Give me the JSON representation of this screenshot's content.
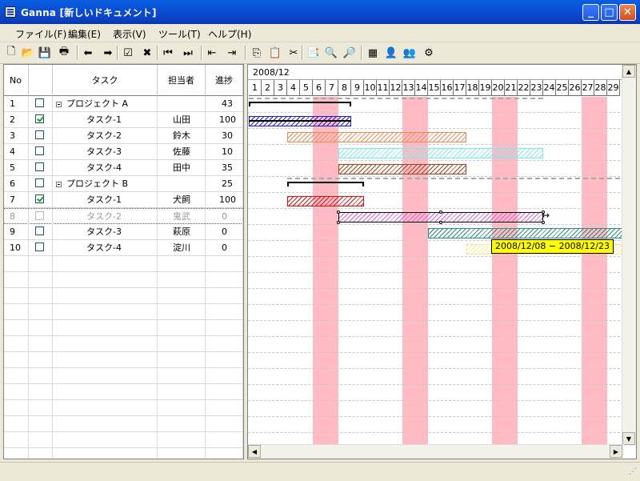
{
  "window": {
    "title": "Ganna [新しいドキュメント]",
    "minimize": "_",
    "maximize": "□",
    "close": "✕"
  },
  "menu": [
    "ファイル(F)",
    "編集(E)",
    "表示(V)",
    "ツール(T)",
    "ヘルプ(H)"
  ],
  "toolbar": [
    {
      "name": "new-icon",
      "glyph": "🗋"
    },
    {
      "name": "open-icon",
      "glyph": "📂"
    },
    {
      "name": "save-icon",
      "glyph": "💾"
    },
    {
      "name": "print-icon",
      "glyph": "🖶"
    },
    {
      "name": "arrow-left-icon",
      "glyph": "⬅"
    },
    {
      "name": "arrow-right-icon",
      "glyph": "➡"
    },
    {
      "name": "check-icon",
      "glyph": "☑"
    },
    {
      "name": "delete-icon",
      "glyph": "✖"
    },
    {
      "name": "first-icon",
      "glyph": "⏮"
    },
    {
      "name": "last-icon",
      "glyph": "⏭"
    },
    {
      "name": "outdent-icon",
      "glyph": "⇤"
    },
    {
      "name": "indent-icon",
      "glyph": "⇥"
    },
    {
      "name": "copy-icon",
      "glyph": "⎘"
    },
    {
      "name": "paste-icon",
      "glyph": "📋"
    },
    {
      "name": "cut-icon",
      "glyph": "✂"
    },
    {
      "name": "import-icon",
      "glyph": "📑"
    },
    {
      "name": "zoom-in-icon",
      "glyph": "🔍"
    },
    {
      "name": "zoom-out-icon",
      "glyph": "🔎"
    },
    {
      "name": "table-icon",
      "glyph": "▦"
    },
    {
      "name": "user-icon",
      "glyph": "👤"
    },
    {
      "name": "users-icon",
      "glyph": "👥"
    },
    {
      "name": "gear-icon",
      "glyph": "⚙"
    }
  ],
  "grid": {
    "headers": {
      "no": "No",
      "task": "タスク",
      "assignee": "担当者",
      "progress": "進捗"
    },
    "rows": [
      {
        "no": "1",
        "checked": false,
        "task": "プロジェクト A",
        "assignee": "",
        "progress": "43",
        "group": true
      },
      {
        "no": "2",
        "checked": true,
        "task": "タスク-1",
        "assignee": "山田",
        "progress": "100"
      },
      {
        "no": "3",
        "checked": false,
        "task": "タスク-2",
        "assignee": "鈴木",
        "progress": "30"
      },
      {
        "no": "4",
        "checked": false,
        "task": "タスク-3",
        "assignee": "佐藤",
        "progress": "10"
      },
      {
        "no": "5",
        "checked": false,
        "task": "タスク-4",
        "assignee": "田中",
        "progress": "35"
      },
      {
        "no": "6",
        "checked": false,
        "task": "プロジェクト B",
        "assignee": "",
        "progress": "25",
        "group": true
      },
      {
        "no": "7",
        "checked": true,
        "task": "タスク-1",
        "assignee": "犬飼",
        "progress": "100"
      },
      {
        "no": "8",
        "checked": false,
        "task": "タスク-2",
        "assignee": "鬼武",
        "progress": "0",
        "dim": true
      },
      {
        "no": "9",
        "checked": false,
        "task": "タスク-3",
        "assignee": "萩原",
        "progress": "0"
      },
      {
        "no": "10",
        "checked": false,
        "task": "タスク-4",
        "assignee": "淀川",
        "progress": "0"
      }
    ]
  },
  "gantt": {
    "month": "2008/12",
    "days": [
      "1",
      "2",
      "3",
      "4",
      "5",
      "6",
      "7",
      "8",
      "9",
      "10",
      "11",
      "12",
      "13",
      "14",
      "15",
      "16",
      "17",
      "18",
      "19",
      "20",
      "21",
      "22",
      "23",
      "24",
      "25",
      "26",
      "27",
      "28",
      "29"
    ],
    "weekend_color": "#ffb6c1",
    "tooltip": "2008/12/08 − 2008/12/23"
  },
  "colors": {
    "blue": "#1d1dd8",
    "orange": "#f08c56",
    "cyan": "#7ee8f0",
    "brown": "#a0451a",
    "red": "#dd1111",
    "magenta": "#e060d8",
    "teal": "#2a8f80"
  }
}
